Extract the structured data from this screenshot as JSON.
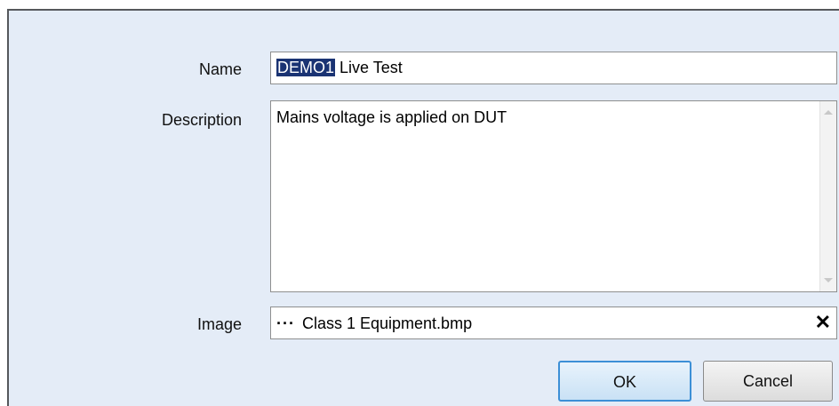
{
  "form": {
    "name_label": "Name",
    "name_selected": "DEMO1",
    "name_rest": " Live Test",
    "description_label": "Description",
    "description_value": "Mains voltage is applied on DUT",
    "image_label": "Image",
    "image_browse_glyph": "···",
    "image_value": "Class 1 Equipment.bmp",
    "image_clear_glyph": "✕"
  },
  "buttons": {
    "ok_label": "OK",
    "cancel_label": "Cancel"
  },
  "icons": {
    "browse": "ellipsis-icon",
    "clear": "close-icon"
  },
  "colors": {
    "dialog_background": "#e4ecf7",
    "selection_highlight": "#1a3373",
    "ok_border": "#3c8fd6"
  }
}
